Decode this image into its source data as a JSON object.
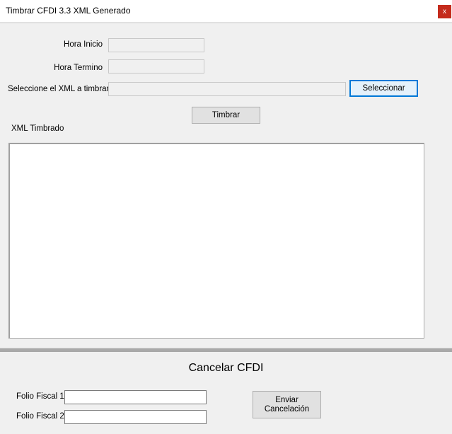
{
  "window": {
    "title": "Timbrar CFDI 3.3 XML Generado",
    "close_label": "x"
  },
  "form": {
    "hora_inicio_label": "Hora Inicio",
    "hora_inicio_value": "",
    "hora_termino_label": "Hora Termino",
    "hora_termino_value": "",
    "xml_label": "Seleccione el XML a timbrar:",
    "xml_value": "",
    "seleccionar_label": "Seleccionar",
    "timbrar_label": "Timbrar",
    "xml_timbrado_label": "XML Timbrado",
    "xml_timbrado_value": ""
  },
  "cancel": {
    "heading": "Cancelar CFDI",
    "folio1_label": "Folio Fiscal 1:",
    "folio1_value": "",
    "folio2_label": "Folio Fiscal 2:",
    "folio2_value": "",
    "enviar_label": "Enviar\nCancelación"
  }
}
